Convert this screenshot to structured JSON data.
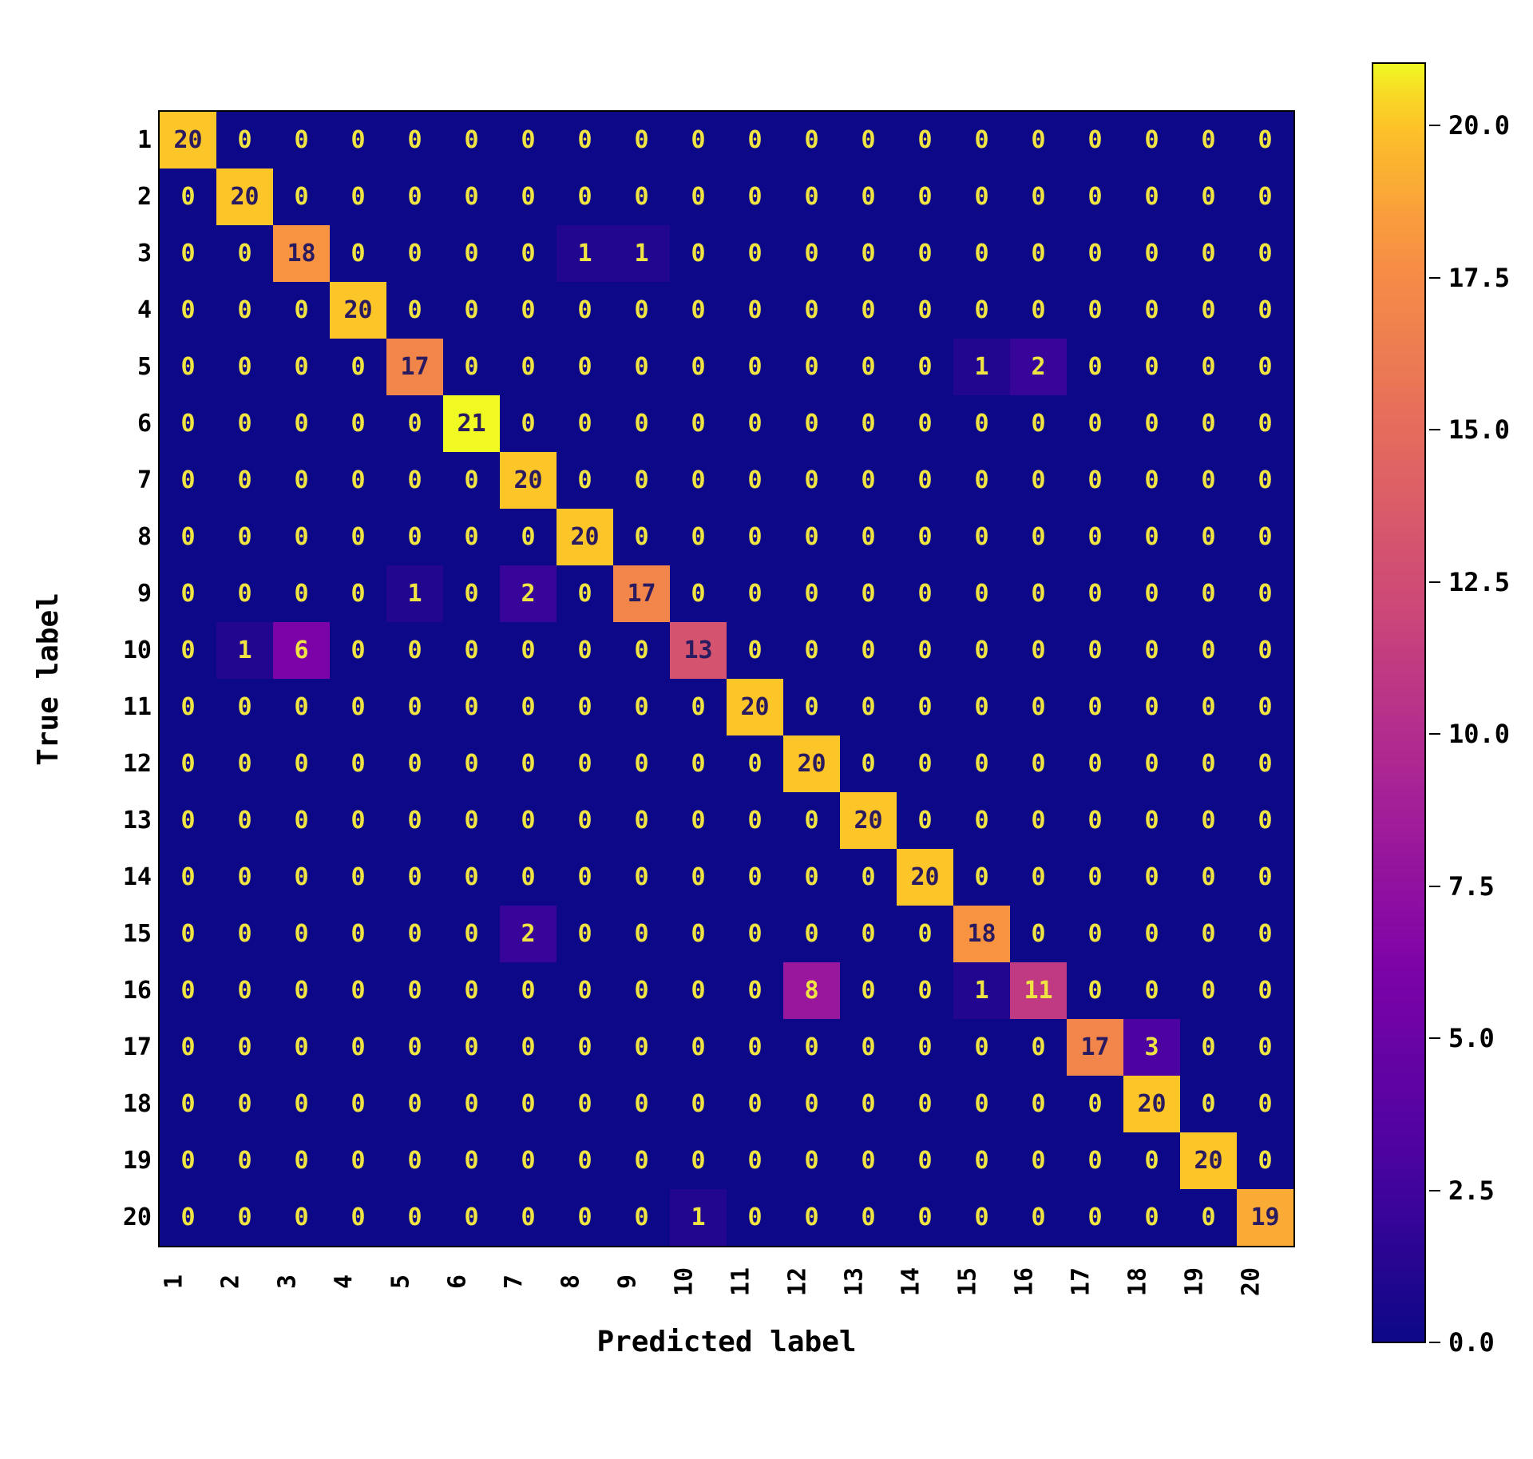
{
  "chart_data": {
    "type": "heatmap",
    "title": "",
    "xlabel": "Predicted label",
    "ylabel": "True label",
    "x_categories": [
      "1",
      "2",
      "3",
      "4",
      "5",
      "6",
      "7",
      "8",
      "9",
      "10",
      "11",
      "12",
      "13",
      "14",
      "15",
      "16",
      "17",
      "18",
      "19",
      "20"
    ],
    "y_categories": [
      "1",
      "2",
      "3",
      "4",
      "5",
      "6",
      "7",
      "8",
      "9",
      "10",
      "11",
      "12",
      "13",
      "14",
      "15",
      "16",
      "17",
      "18",
      "19",
      "20"
    ],
    "matrix": [
      [
        20,
        0,
        0,
        0,
        0,
        0,
        0,
        0,
        0,
        0,
        0,
        0,
        0,
        0,
        0,
        0,
        0,
        0,
        0,
        0
      ],
      [
        0,
        20,
        0,
        0,
        0,
        0,
        0,
        0,
        0,
        0,
        0,
        0,
        0,
        0,
        0,
        0,
        0,
        0,
        0,
        0
      ],
      [
        0,
        0,
        18,
        0,
        0,
        0,
        0,
        1,
        1,
        0,
        0,
        0,
        0,
        0,
        0,
        0,
        0,
        0,
        0,
        0
      ],
      [
        0,
        0,
        0,
        20,
        0,
        0,
        0,
        0,
        0,
        0,
        0,
        0,
        0,
        0,
        0,
        0,
        0,
        0,
        0,
        0
      ],
      [
        0,
        0,
        0,
        0,
        17,
        0,
        0,
        0,
        0,
        0,
        0,
        0,
        0,
        0,
        1,
        2,
        0,
        0,
        0,
        0
      ],
      [
        0,
        0,
        0,
        0,
        0,
        21,
        0,
        0,
        0,
        0,
        0,
        0,
        0,
        0,
        0,
        0,
        0,
        0,
        0,
        0
      ],
      [
        0,
        0,
        0,
        0,
        0,
        0,
        20,
        0,
        0,
        0,
        0,
        0,
        0,
        0,
        0,
        0,
        0,
        0,
        0,
        0
      ],
      [
        0,
        0,
        0,
        0,
        0,
        0,
        0,
        20,
        0,
        0,
        0,
        0,
        0,
        0,
        0,
        0,
        0,
        0,
        0,
        0
      ],
      [
        0,
        0,
        0,
        0,
        1,
        0,
        2,
        0,
        17,
        0,
        0,
        0,
        0,
        0,
        0,
        0,
        0,
        0,
        0,
        0
      ],
      [
        0,
        1,
        6,
        0,
        0,
        0,
        0,
        0,
        0,
        13,
        0,
        0,
        0,
        0,
        0,
        0,
        0,
        0,
        0,
        0
      ],
      [
        0,
        0,
        0,
        0,
        0,
        0,
        0,
        0,
        0,
        0,
        20,
        0,
        0,
        0,
        0,
        0,
        0,
        0,
        0,
        0
      ],
      [
        0,
        0,
        0,
        0,
        0,
        0,
        0,
        0,
        0,
        0,
        0,
        20,
        0,
        0,
        0,
        0,
        0,
        0,
        0,
        0
      ],
      [
        0,
        0,
        0,
        0,
        0,
        0,
        0,
        0,
        0,
        0,
        0,
        0,
        20,
        0,
        0,
        0,
        0,
        0,
        0,
        0
      ],
      [
        0,
        0,
        0,
        0,
        0,
        0,
        0,
        0,
        0,
        0,
        0,
        0,
        0,
        20,
        0,
        0,
        0,
        0,
        0,
        0
      ],
      [
        0,
        0,
        0,
        0,
        0,
        0,
        2,
        0,
        0,
        0,
        0,
        0,
        0,
        0,
        18,
        0,
        0,
        0,
        0,
        0
      ],
      [
        0,
        0,
        0,
        0,
        0,
        0,
        0,
        0,
        0,
        0,
        0,
        8,
        0,
        0,
        1,
        11,
        0,
        0,
        0,
        0
      ],
      [
        0,
        0,
        0,
        0,
        0,
        0,
        0,
        0,
        0,
        0,
        0,
        0,
        0,
        0,
        0,
        0,
        17,
        3,
        0,
        0
      ],
      [
        0,
        0,
        0,
        0,
        0,
        0,
        0,
        0,
        0,
        0,
        0,
        0,
        0,
        0,
        0,
        0,
        0,
        20,
        0,
        0
      ],
      [
        0,
        0,
        0,
        0,
        0,
        0,
        0,
        0,
        0,
        0,
        0,
        0,
        0,
        0,
        0,
        0,
        0,
        0,
        20,
        0
      ],
      [
        0,
        0,
        0,
        0,
        0,
        0,
        0,
        0,
        0,
        1,
        0,
        0,
        0,
        0,
        0,
        0,
        0,
        0,
        0,
        19
      ]
    ],
    "colorbar_ticks": [
      "0.0",
      "2.5",
      "5.0",
      "7.5",
      "10.0",
      "12.5",
      "15.0",
      "17.5",
      "20.0"
    ],
    "colormap": "plasma",
    "vmin": 0,
    "vmax": 21
  }
}
